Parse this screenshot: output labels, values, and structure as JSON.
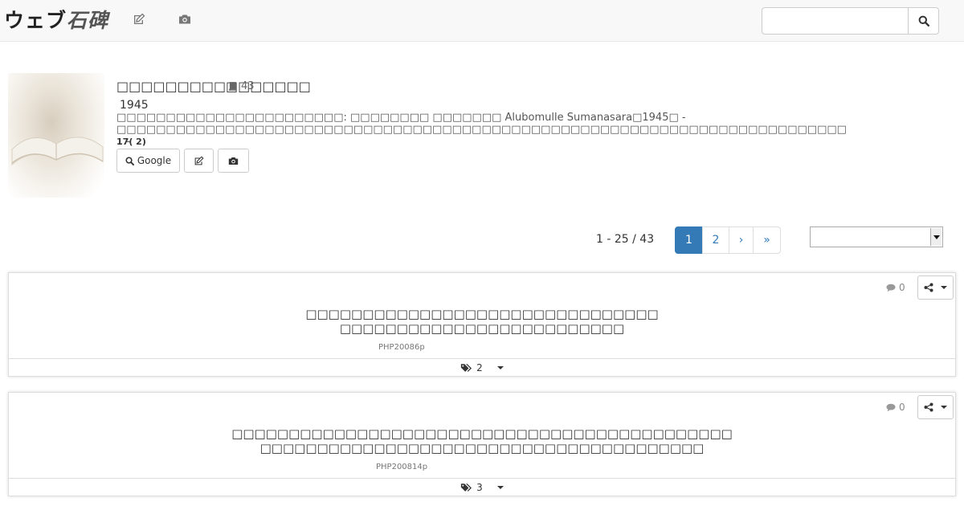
{
  "header": {
    "brand_text_1": "ウェブ",
    "brand_text_2": "石碑",
    "icons": [
      "edit-icon",
      "camera-icon"
    ],
    "search_value": "",
    "search_icon": "search-icon"
  },
  "book": {
    "title": "□□□□□□□□□□□□□□□□",
    "count": "43",
    "year": "1945",
    "description": "□□□□□□□□□□□□□□□□□□□□□□□: □□□□□□□□ □□□□□□□ Alubomulle Sumanasara□1945□ - □□□□□□□□□□□□□□□□□□□□□□□□□□□□□□□□□□□□□□□□□□□□□□□□□□□□□□□□□□□□□□□□□□□□□□□□□□",
    "description_more": "...-",
    "stats_a": "17",
    "stats_b": "2",
    "google_label": "Google"
  },
  "pagination": {
    "range": "1 - 25 / 43",
    "pages": [
      "1",
      "2",
      "›",
      "»"
    ],
    "active_page": "1",
    "sort_value": ""
  },
  "results": [
    {
      "comments": "0",
      "title_line1": "□□□□□□□□□□□□□□□□□□□□□□□□□□□□□□□",
      "title_line2": "□□□□□□□□□□□□□□□□□□□□□□□□□",
      "code": "PHP20086p",
      "tags": "2"
    },
    {
      "comments": "0",
      "title_line1": "□□□□□□□□□□□□□□□□□□□□□□□□□□□□□□□□□□□□□□□□□□□□",
      "title_line2": "□□□□□□□□□□□□□□□□□□□□□□□□□□□□□□□□□□□□□□□",
      "code": "PHP200814p",
      "tags": "3"
    }
  ]
}
